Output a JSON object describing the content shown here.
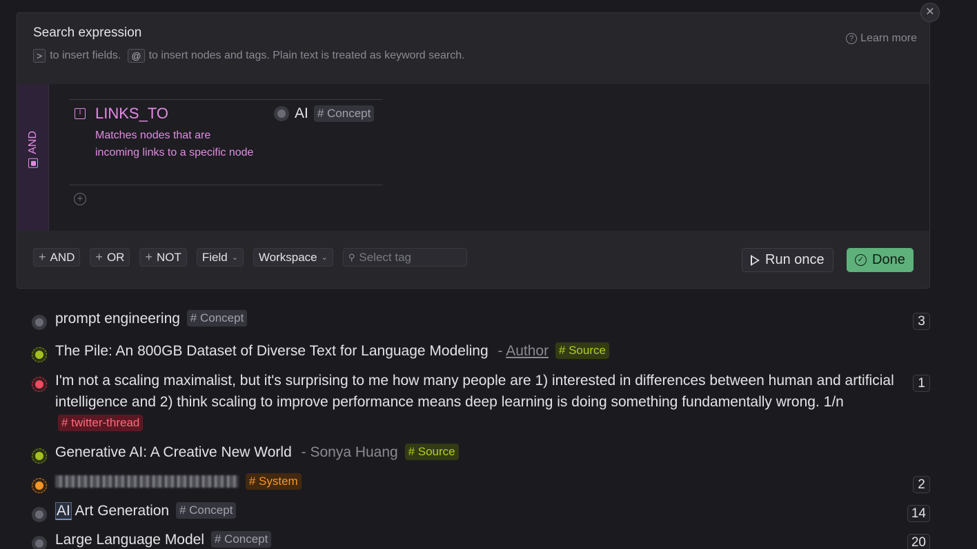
{
  "panel": {
    "title": "Search expression",
    "hint": {
      "key_fields": ">",
      "text_fields": "to insert fields.",
      "key_nodes": "@",
      "text_nodes": "to insert nodes and tags. Plain text is treated as keyword search."
    },
    "learn_more": "Learn more",
    "close_glyph": "✕"
  },
  "expression": {
    "operator": "AND",
    "rule": {
      "name": "LINKS_TO",
      "description": "Matches nodes that are incoming links to a specific node",
      "value": "AI",
      "value_tag": "# Concept"
    }
  },
  "toolbar": {
    "and_label": "AND",
    "or_label": "OR",
    "not_label": "NOT",
    "field_label": "Field",
    "workspace_label": "Workspace",
    "tag_placeholder": "Select tag",
    "run_label": "Run once",
    "done_label": "Done"
  },
  "results": [
    {
      "title": "prompt engineering",
      "tag": "# Concept",
      "tag_kind": "concept",
      "bullet": "gray",
      "count": "3"
    },
    {
      "title": "The Pile: An 800GB Dataset of Diverse Text for Language Modeling",
      "meta_prefix": "-",
      "meta_link": "Author",
      "tag": "# Source",
      "tag_kind": "source",
      "bullet": "green",
      "count": ""
    },
    {
      "title": " I'm not a scaling maximalist, but it's surprising to me how many people are 1) interested in differences between human and artificial intelligence and 2) think scaling to improve performance means deep learning is doing something fundamentally wrong. 1/n",
      "tag": "# twitter-thread",
      "tag_kind": "twitter",
      "bullet": "red",
      "count": "1"
    },
    {
      "title": "Generative AI: A Creative New World",
      "meta": "- Sonya Huang",
      "tag": "# Source",
      "tag_kind": "source",
      "bullet": "green",
      "count": ""
    },
    {
      "title": "",
      "tag": "# System",
      "tag_kind": "system",
      "bullet": "orange",
      "count": "2"
    },
    {
      "title_hl": "AI",
      "title": " Art Generation",
      "tag": "# Concept",
      "tag_kind": "concept",
      "bullet": "gray",
      "count": "14"
    },
    {
      "title": "Large Language Model",
      "tag": "# Concept",
      "tag_kind": "concept",
      "bullet": "gray",
      "count": "20"
    }
  ]
}
